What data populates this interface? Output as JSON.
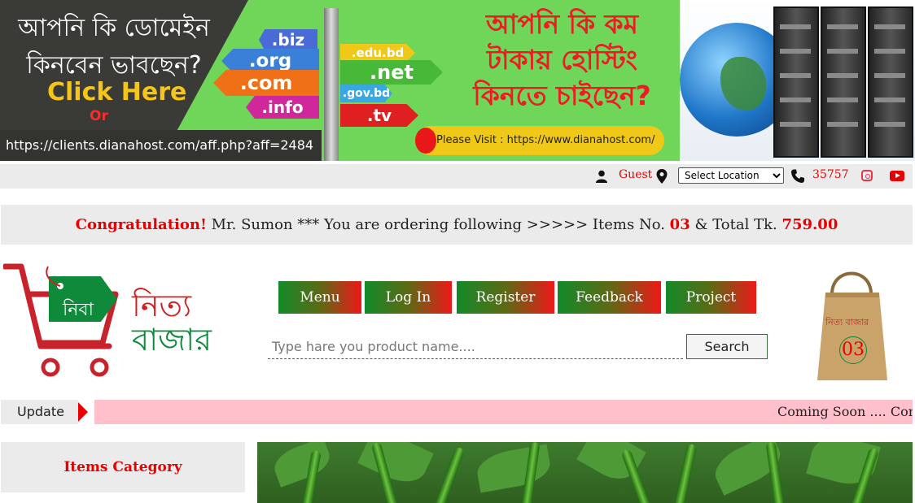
{
  "banner": {
    "question_line1": "আপনি কি ডোমেইন",
    "question_line2": "কিনবেন ভাবছেন?",
    "click_here": "Click Here",
    "or": "Or",
    "aff_url": "https://clients.dianahost.com/aff.php?aff=2484",
    "domain_signs": [
      ".biz",
      ".org",
      ".com",
      ".info",
      ".edu.bd",
      ".net",
      ".gov.bd",
      ".tv"
    ],
    "hosting_line1": "আপনি কি কম",
    "hosting_line2": "টাকায় হোস্টিং",
    "hosting_line3": "কিনতে চাইছেন?",
    "visit_text": "Please Visit :  https://www.dianahost.com/"
  },
  "topbar": {
    "guest_label": "Guest",
    "location_selected": "Select Location",
    "phone": "35757"
  },
  "congrats": {
    "prefix": "Congratulation!",
    "message": " Mr. Sumon *** You are ordering following >>>>> Items No. ",
    "items_no": "03",
    "total_label": " & Total Tk. ",
    "total": "759.00"
  },
  "logo": {
    "tag_text": "নিবা",
    "name_line1": "নিত্য",
    "name_line2": "বাজার"
  },
  "nav": {
    "items": [
      "Menu",
      "Log In",
      "Register",
      "Feedback",
      "Project"
    ]
  },
  "search": {
    "placeholder": "Type hare you product name....",
    "button": "Search"
  },
  "cart": {
    "bag_text": "নিত্য বাজার",
    "count": "03"
  },
  "ticker": {
    "label": "Update",
    "text": "Coming Soon .... Coming Soon .... Coming Soon"
  },
  "sidebar": {
    "category_title": "Items Category"
  },
  "colors": {
    "accent_red": "#e80000",
    "brand_green": "#0e8a3a",
    "ticker_bg": "#ffc0cb"
  }
}
